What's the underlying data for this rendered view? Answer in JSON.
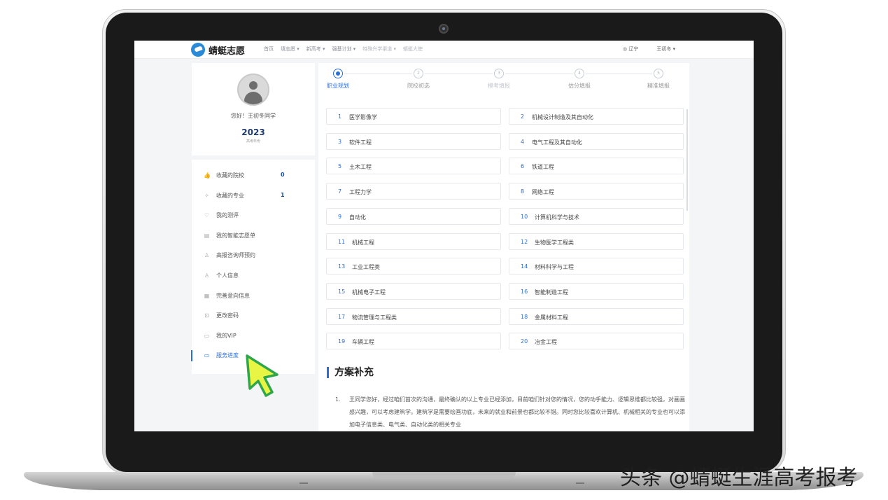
{
  "nav": {
    "logo": "蜻蜓志愿",
    "items": [
      {
        "label": "首页",
        "dim": false
      },
      {
        "label": "填志愿 ▾",
        "dim": false
      },
      {
        "label": "新高考 ▾",
        "dim": false
      },
      {
        "label": "强基计划 ▾",
        "dim": false
      },
      {
        "label": "特殊升学渠道 ▾",
        "dim": true
      },
      {
        "label": "蜻蜓大使",
        "dim": true
      }
    ],
    "location": "◎ 辽宁",
    "user": "王初冬 ▾"
  },
  "profile": {
    "greeting": "您好！王初冬同学",
    "year": "2023",
    "year_label": "高考年份"
  },
  "menu": [
    {
      "icon": "thumb-up-icon",
      "glyph": "👍",
      "label": "收藏的院校",
      "count": "0"
    },
    {
      "icon": "sparkle-icon",
      "glyph": "✧",
      "label": "收藏的专业",
      "count": "1"
    },
    {
      "icon": "heart-icon",
      "glyph": "♡",
      "label": "我的测评",
      "count": ""
    },
    {
      "icon": "document-icon",
      "glyph": "▤",
      "label": "我的智能志愿单",
      "count": ""
    },
    {
      "icon": "person-icon",
      "glyph": "♙",
      "label": "高报咨询师预约",
      "count": ""
    },
    {
      "icon": "person-icon",
      "glyph": "♙",
      "label": "个人信息",
      "count": ""
    },
    {
      "icon": "form-icon",
      "glyph": "▦",
      "label": "完善意向信息",
      "count": ""
    },
    {
      "icon": "lock-icon",
      "glyph": "⊡",
      "label": "更改密码",
      "count": ""
    },
    {
      "icon": "card-icon",
      "glyph": "▭",
      "label": "我的VIP",
      "count": ""
    },
    {
      "icon": "progress-icon",
      "glyph": "▭",
      "label": "服务进度",
      "count": "",
      "active": true
    }
  ],
  "steps": [
    {
      "num": "",
      "label": "职业规划",
      "state": "current"
    },
    {
      "num": "2",
      "label": "院校初选",
      "state": "normal"
    },
    {
      "num": "3",
      "label": "模考填报",
      "state": "dim"
    },
    {
      "num": "4",
      "label": "估分填报",
      "state": "normal"
    },
    {
      "num": "5",
      "label": "精准填报",
      "state": "normal"
    }
  ],
  "majors": [
    {
      "num": "1",
      "name": "医学影像学"
    },
    {
      "num": "2",
      "name": "机械设计制造及其自动化"
    },
    {
      "num": "3",
      "name": "软件工程"
    },
    {
      "num": "4",
      "name": "电气工程及其自动化"
    },
    {
      "num": "5",
      "name": "土木工程"
    },
    {
      "num": "6",
      "name": "铁道工程"
    },
    {
      "num": "7",
      "name": "工程力学"
    },
    {
      "num": "8",
      "name": "网络工程"
    },
    {
      "num": "9",
      "name": "自动化"
    },
    {
      "num": "10",
      "name": "计算机科学与技术"
    },
    {
      "num": "11",
      "name": "机械工程"
    },
    {
      "num": "12",
      "name": "生物医学工程类"
    },
    {
      "num": "13",
      "name": "工业工程类"
    },
    {
      "num": "14",
      "name": "材料科学与工程"
    },
    {
      "num": "15",
      "name": "机械电子工程"
    },
    {
      "num": "16",
      "name": "智能制造工程"
    },
    {
      "num": "17",
      "name": "物流管理与工程类"
    },
    {
      "num": "18",
      "name": "金属材料工程"
    },
    {
      "num": "19",
      "name": "车辆工程"
    },
    {
      "num": "20",
      "name": "冶金工程"
    }
  ],
  "supplement": {
    "title": "方案补充",
    "num": "1.",
    "text": "王同学您好，经过咱们首次的沟通，最终确认的以上专业已经添加，目前咱们针对您的情况，您的动手能力、逻辑思维都比较强，对画画感兴趣，可以考虑建筑学。建筑学是需要绘画功底，未来的就业和前景也都比较不错。同时您比较喜欢计算机、机械相关的专业也可以添加电子信息类、电气类、自动化类的相关专业"
  },
  "watermark": "头条 @蜻蜓生涯高考报考",
  "colors": {
    "accent": "#2b6fd4",
    "brand": "#2b8ad8",
    "cursor": "#e8f545"
  }
}
